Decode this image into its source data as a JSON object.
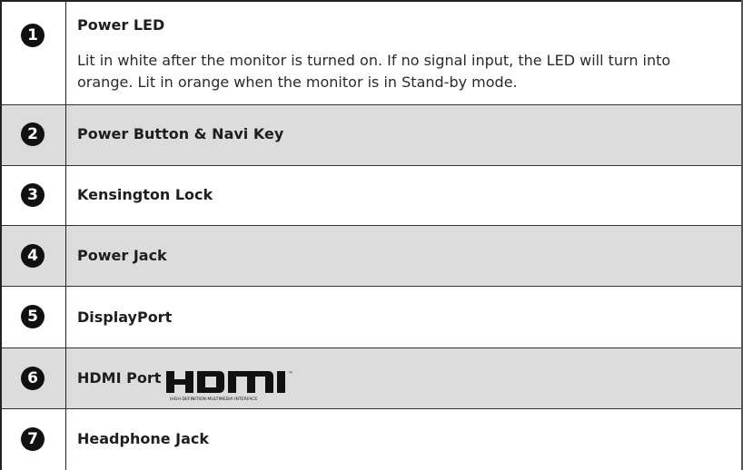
{
  "rows": [
    {
      "num": "1",
      "title": "Power LED",
      "desc": "Lit in white after the monitor is turned on. If no signal input, the LED will turn into orange. Lit in orange when the monitor is in Stand-by mode."
    },
    {
      "num": "2",
      "title": "Power Button & Navi Key"
    },
    {
      "num": "3",
      "title": "Kensington Lock"
    },
    {
      "num": "4",
      "title": "Power Jack"
    },
    {
      "num": "5",
      "title": "DisplayPort"
    },
    {
      "num": "6",
      "title": "HDMI Port"
    },
    {
      "num": "7",
      "title": "Headphone Jack"
    }
  ],
  "hdmi_logo": {
    "text": "HDMI",
    "tagline": "HIGH-DEFINITION MULTIMEDIA INTERFACE",
    "tm": "™"
  }
}
